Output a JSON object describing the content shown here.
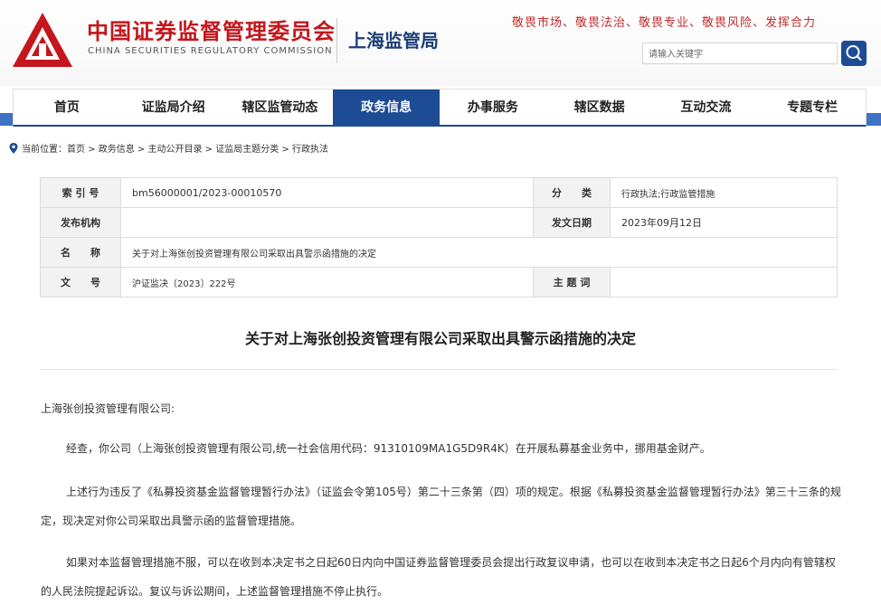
{
  "header": {
    "org_cn": "中国证券监督管理委员会",
    "org_en": "CHINA SECURITIES REGULATORY COMMISSION",
    "bureau": "上海监管局",
    "slogan": "敬畏市场、敬畏法治、敬畏专业、敬畏风险、发挥合力",
    "search_placeholder": "请输入关键字",
    "brand_color": "#c4161c",
    "accent_color": "#1d4b94"
  },
  "nav": {
    "items": [
      "首页",
      "证监局介绍",
      "辖区监管动态",
      "政务信息",
      "办事服务",
      "辖区数据",
      "互动交流",
      "专题专栏"
    ],
    "active_index": 3
  },
  "breadcrumb": "当前位置：首页 > 政务信息 > 主动公开目录 > 证监局主题分类 > 行政执法",
  "meta": {
    "index_label": "索 引 号",
    "index_value": "bm56000001/2023-00010570",
    "category_label": "分　　类",
    "category_value": "行政执法;行政监管措施",
    "issuer_label": "发布机构",
    "issuer_value": "",
    "date_label": "发文日期",
    "date_value": "2023年09月12日",
    "name_label": "名　　称",
    "name_value": "关于对上海张创投资管理有限公司采取出具警示函措施的决定",
    "docno_label": "文　　号",
    "docno_value": "沪证监决〔2023〕222号",
    "subject_label": "主 题 词",
    "subject_value": ""
  },
  "document": {
    "title": "关于对上海张创投资管理有限公司采取出具警示函措施的决定",
    "salutation": "上海张创投资管理有限公司:",
    "paragraphs": [
      "经查，你公司（上海张创投资管理有限公司,统一社会信用代码：91310109MA1G5D9R4K）在开展私募基金业务中，挪用基金财产。",
      "上述行为违反了《私募投资基金监督管理暂行办法》（证监会令第105号）第二十三条第（四）项的规定。根据《私募投资基金监督管理暂行办法》第三十三条的规定，现决定对你公司采取出具警示函的监督管理措施。",
      "如果对本监督管理措施不服，可以在收到本决定书之日起60日内向中国证券监督管理委员会提出行政复议申请，也可以在收到本决定书之日起6个月内向有管辖权的人民法院提起诉讼。复议与诉讼期间，上述监督管理措施不停止执行。"
    ]
  }
}
